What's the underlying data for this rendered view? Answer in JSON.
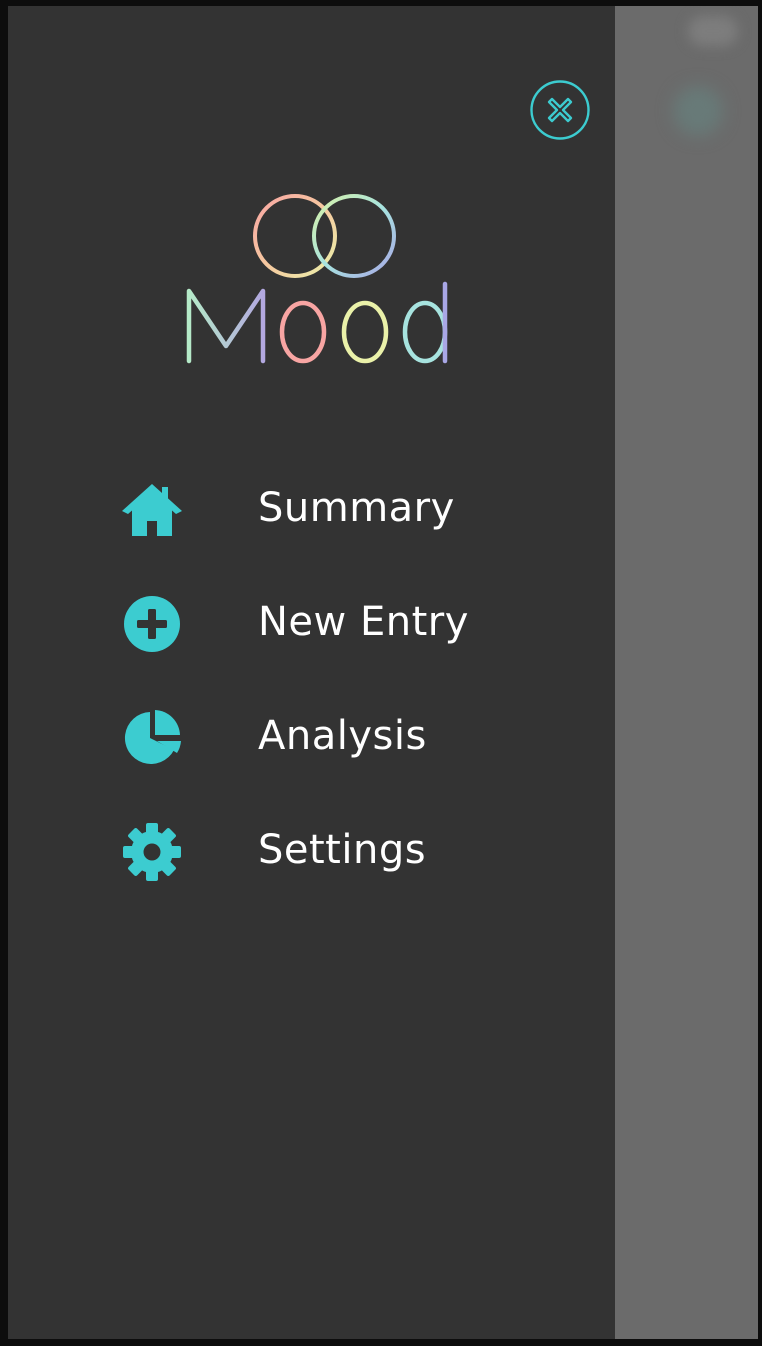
{
  "app": {
    "name": "Mood",
    "accent_color": "#3cccd0",
    "drawer_color": "#333333",
    "overlay_color": "#6b6b6b",
    "logo_colors": [
      "#b5eac8",
      "#b3a8e0",
      "#f8a5a3",
      "#eaf1a9",
      "#a7e3df",
      "#a9a7e6"
    ]
  },
  "drawer": {
    "close_icon": "close-circle-icon",
    "items": [
      {
        "label": "Summary",
        "icon": "home-icon"
      },
      {
        "label": "New Entry",
        "icon": "plus-circle-icon"
      },
      {
        "label": "Analysis",
        "icon": "pie-chart-icon"
      },
      {
        "label": "Settings",
        "icon": "gear-icon"
      }
    ]
  }
}
